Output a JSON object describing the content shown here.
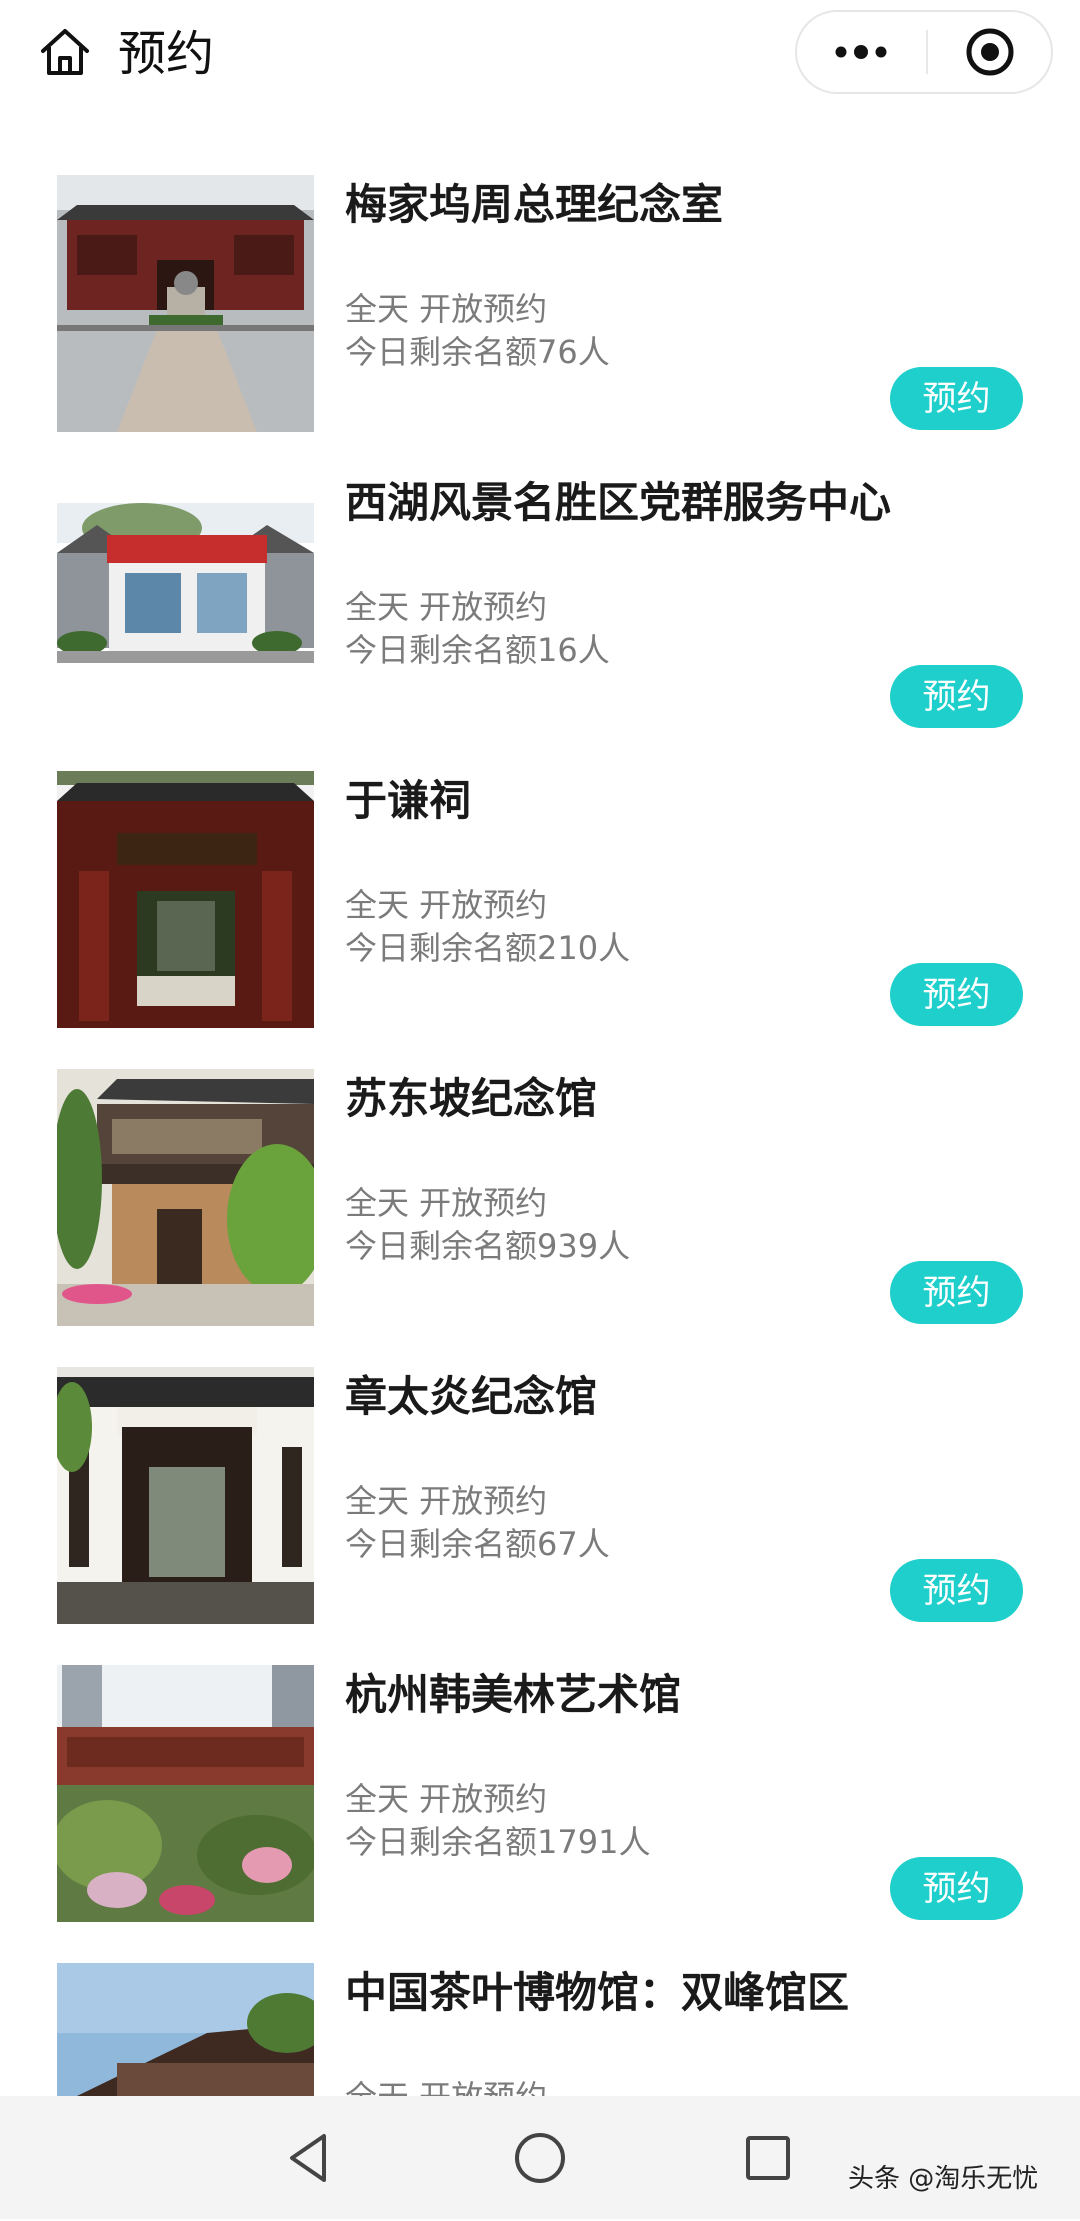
{
  "header": {
    "title": "预约",
    "home_icon": "home-icon",
    "more_icon": "more-dots-icon",
    "close_icon": "record-close-icon"
  },
  "items": [
    {
      "name": "梅家坞周总理纪念室",
      "hours": "全天 开放预约",
      "quota": "今日剩余名额76人",
      "button": "预约"
    },
    {
      "name": "西湖风景名胜区党群服务中心",
      "hours": "全天 开放预约",
      "quota": "今日剩余名额16人",
      "button": "预约"
    },
    {
      "name": "于谦祠",
      "hours": "全天 开放预约",
      "quota": "今日剩余名额210人",
      "button": "预约"
    },
    {
      "name": "苏东坡纪念馆",
      "hours": "全天 开放预约",
      "quota": "今日剩余名额939人",
      "button": "预约"
    },
    {
      "name": "章太炎纪念馆",
      "hours": "全天 开放预约",
      "quota": "今日剩余名额67人",
      "button": "预约"
    },
    {
      "name": "杭州韩美林艺术馆",
      "hours": "全天 开放预约",
      "quota": "今日剩余名额1791人",
      "button": "预约"
    },
    {
      "name": "中国茶叶博物馆：双峰馆区",
      "hours": "全天 开放预约",
      "quota": "",
      "button": ""
    }
  ],
  "colors": {
    "accent": "#1ecfcb",
    "subtext": "#7b7b7b",
    "navbar_bg": "#f4f4f4"
  },
  "watermark": "头条 @淘乐无忧",
  "navbar": {
    "back_icon": "back-triangle-icon",
    "home_icon": "home-circle-icon",
    "recents_icon": "recents-square-icon"
  }
}
